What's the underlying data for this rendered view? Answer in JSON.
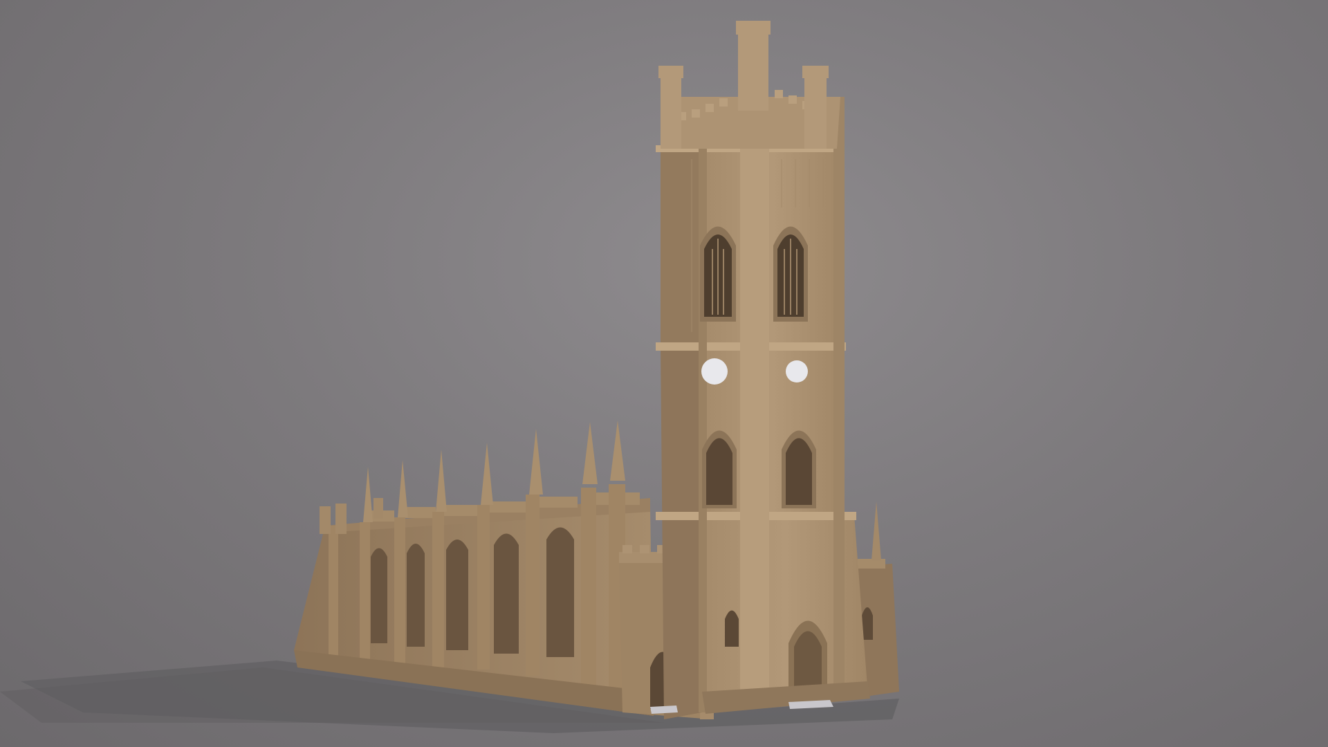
{
  "scene": {
    "subject": "gothic-church-3d-model",
    "colors": {
      "background": "#7d7a7d",
      "stone_light": "#b39a7a",
      "stone_mid": "#9c8262",
      "stone_dark": "#7a6248",
      "window_dark": "#4e3e2e",
      "clock_face": "#e8e8ec",
      "shadow": "#5f5d60"
    }
  }
}
